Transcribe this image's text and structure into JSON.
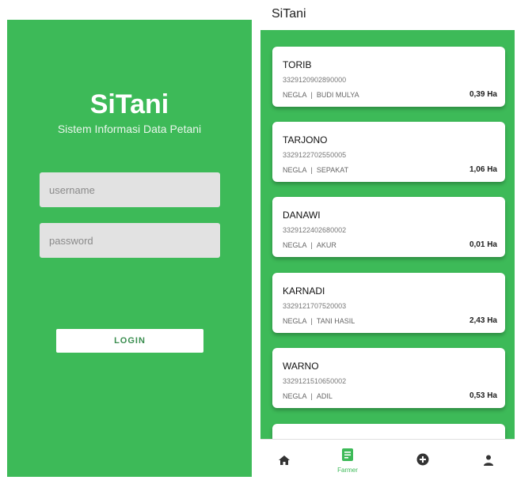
{
  "login": {
    "brand": "SiTani",
    "tagline": "Sistem Informasi Data Petani",
    "username_placeholder": "username",
    "password_placeholder": "password",
    "login_button": "LOGIN"
  },
  "app": {
    "title": "SiTani"
  },
  "farmers": [
    {
      "name": "TORIB",
      "nik": "3329120902890000",
      "village": "NEGLA",
      "group": "BUDI MULYA",
      "area": "0,39 Ha"
    },
    {
      "name": "TARJONO",
      "nik": "3329122702550005",
      "village": "NEGLA",
      "group": "SEPAKAT",
      "area": "1,06 Ha"
    },
    {
      "name": "DANAWI",
      "nik": "3329122402680002",
      "village": "NEGLA",
      "group": "AKUR",
      "area": "0,01 Ha"
    },
    {
      "name": "KARNADI",
      "nik": "3329121707520003",
      "village": "NEGLA",
      "group": "TANI HASIL",
      "area": "2,43 Ha"
    },
    {
      "name": "WARNO",
      "nik": "3329121510650002",
      "village": "NEGLA",
      "group": "ADIL",
      "area": "0,53 Ha"
    }
  ],
  "separator": "|",
  "bottom_nav": {
    "active_label": "Farmer",
    "items": [
      "home-icon",
      "list-icon",
      "add-circle-icon",
      "person-icon"
    ]
  },
  "colors": {
    "primary_green": "#3dba58",
    "card": "#ffffff"
  }
}
